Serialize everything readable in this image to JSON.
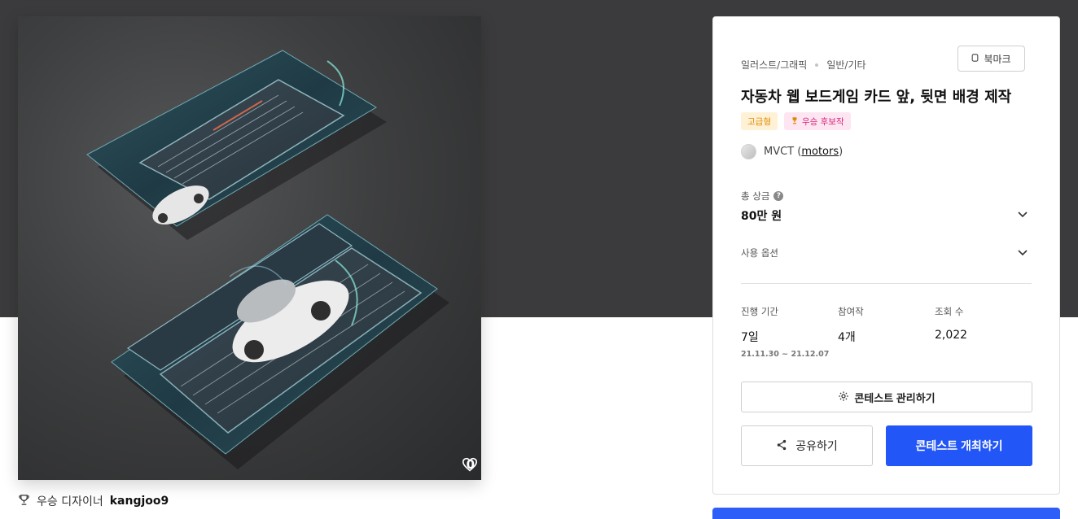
{
  "hero": {
    "likes": "0"
  },
  "winner": {
    "label": "우승 디자이너",
    "username": "kangjoo9"
  },
  "contest": {
    "category_main": "일러스트/그래픽",
    "category_sub": "일반/기타",
    "bookmark_label": "북마크",
    "title": "자동차 웹 보드게임 카드 앞, 뒷면 배경 제작",
    "badge_premium": "고급형",
    "badge_award": "우승 후보작",
    "host_name": "MVCT (",
    "host_handle": "motors",
    "host_suffix": ")",
    "prize_label": "총 상금",
    "prize_value": "80만 원",
    "options_label": "사용 옵션",
    "stats": [
      {
        "label": "진행 기간",
        "value": "7일",
        "sub": "21.11.30  ~  21.12.07"
      },
      {
        "label": "참여작",
        "value": "4개"
      },
      {
        "label": "조회 수",
        "value": "2,022"
      }
    ],
    "manage_label": "콘테스트 관리하기",
    "share_label": "공유하기",
    "host_contest_label": "콘테스트 개최하기"
  },
  "colors": {
    "hero_bg": "#3b3b3d",
    "primary": "#2356f6",
    "premium": "#e08a00",
    "award": "#d6247a"
  },
  "icons": [
    "heart-icon",
    "trophy-icon",
    "bookmark-icon",
    "question-icon",
    "chevron-down-icon",
    "gear-icon",
    "share-icon"
  ]
}
